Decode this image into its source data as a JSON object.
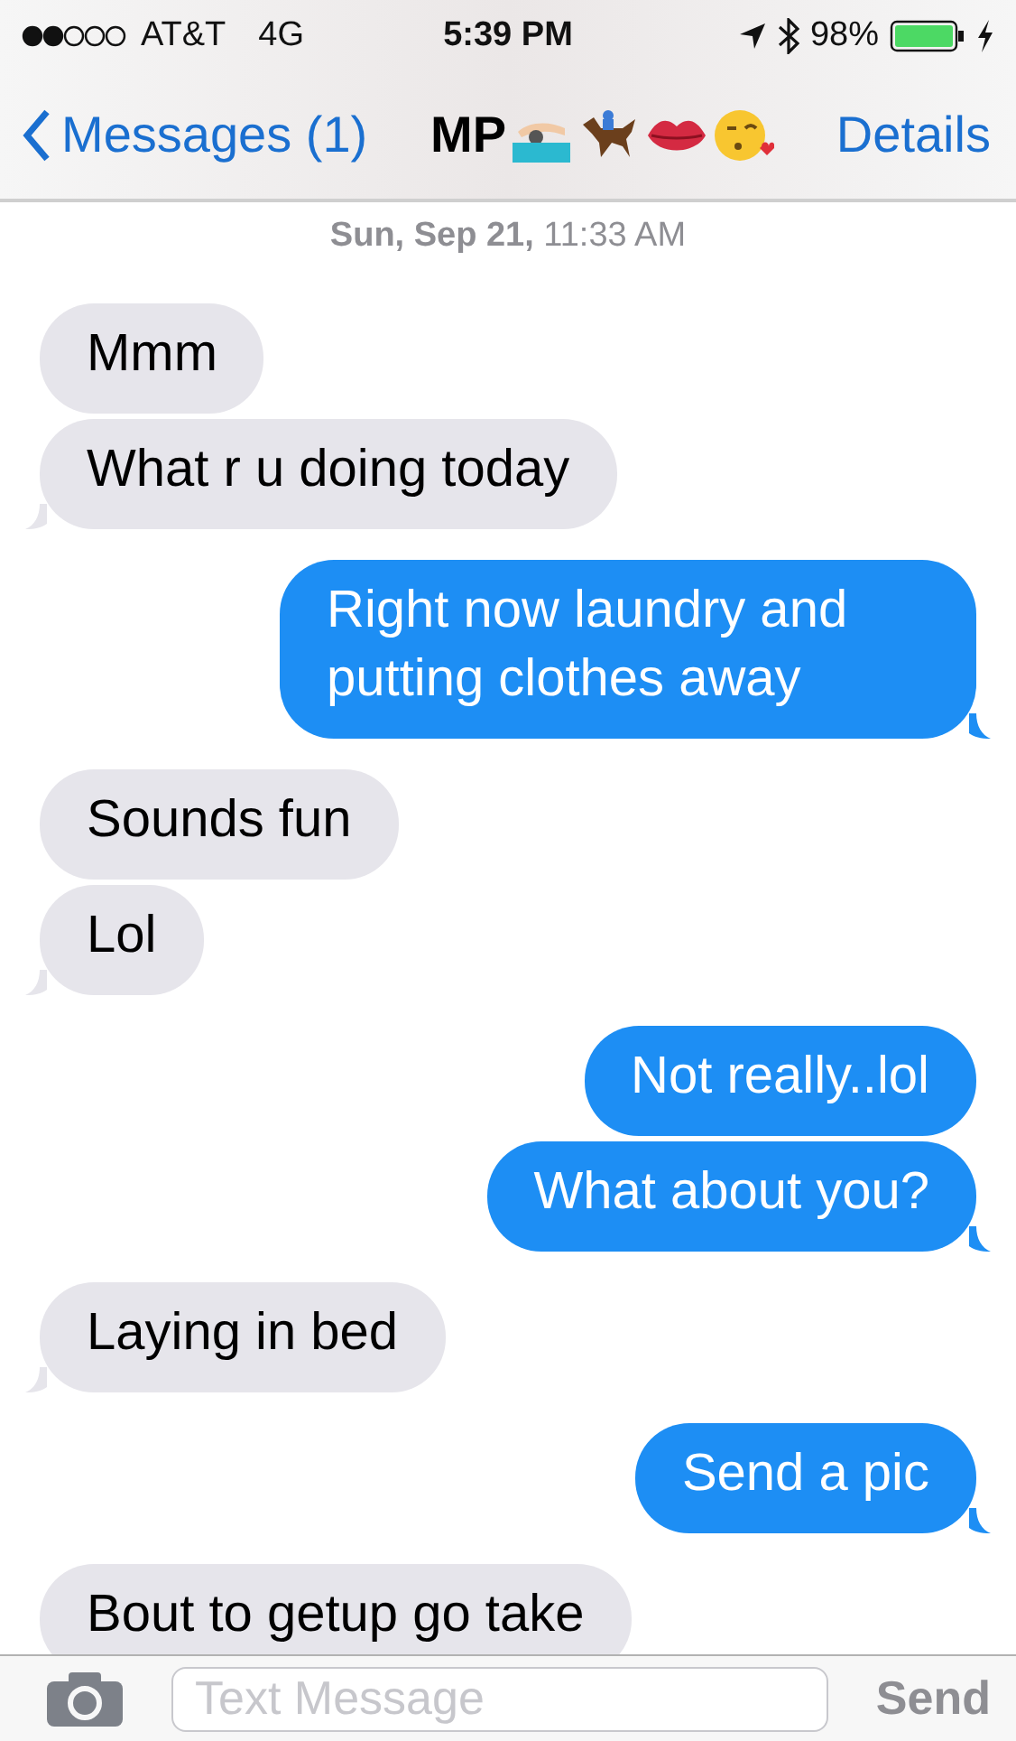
{
  "status_bar": {
    "carrier": "AT&T",
    "network": "4G",
    "time": "5:39 PM",
    "battery": "98%"
  },
  "nav_bar": {
    "back_label": "Messages (1)",
    "title": "MP",
    "action": "Details"
  },
  "timestamp": "**Sun, Sep 21,** 11:33 AM",
  "messages": [
    {
      "kind": "received",
      "text": "Mmm",
      "tail": false
    },
    {
      "kind": "received",
      "text": "What r u doing today",
      "tail": true
    },
    {
      "kind": "sent",
      "text": "Right now laundry and putting clothes away",
      "tail": true
    },
    {
      "kind": "received",
      "text": "Sounds fun",
      "tail": false
    },
    {
      "kind": "received",
      "text": "Lol",
      "tail": true
    },
    {
      "kind": "sent",
      "text": "Not really..lol",
      "tail": false
    },
    {
      "kind": "sent",
      "text": "What about you?",
      "tail": true
    },
    {
      "kind": "received",
      "text": "Laying in bed",
      "tail": true
    },
    {
      "kind": "sent",
      "text": "Send a pic",
      "tail": true
    },
    {
      "kind": "received",
      "text": "Bout to getup go take",
      "tail": false
    }
  ],
  "composer": {
    "placeholder": "Text Message",
    "send": "Send"
  }
}
